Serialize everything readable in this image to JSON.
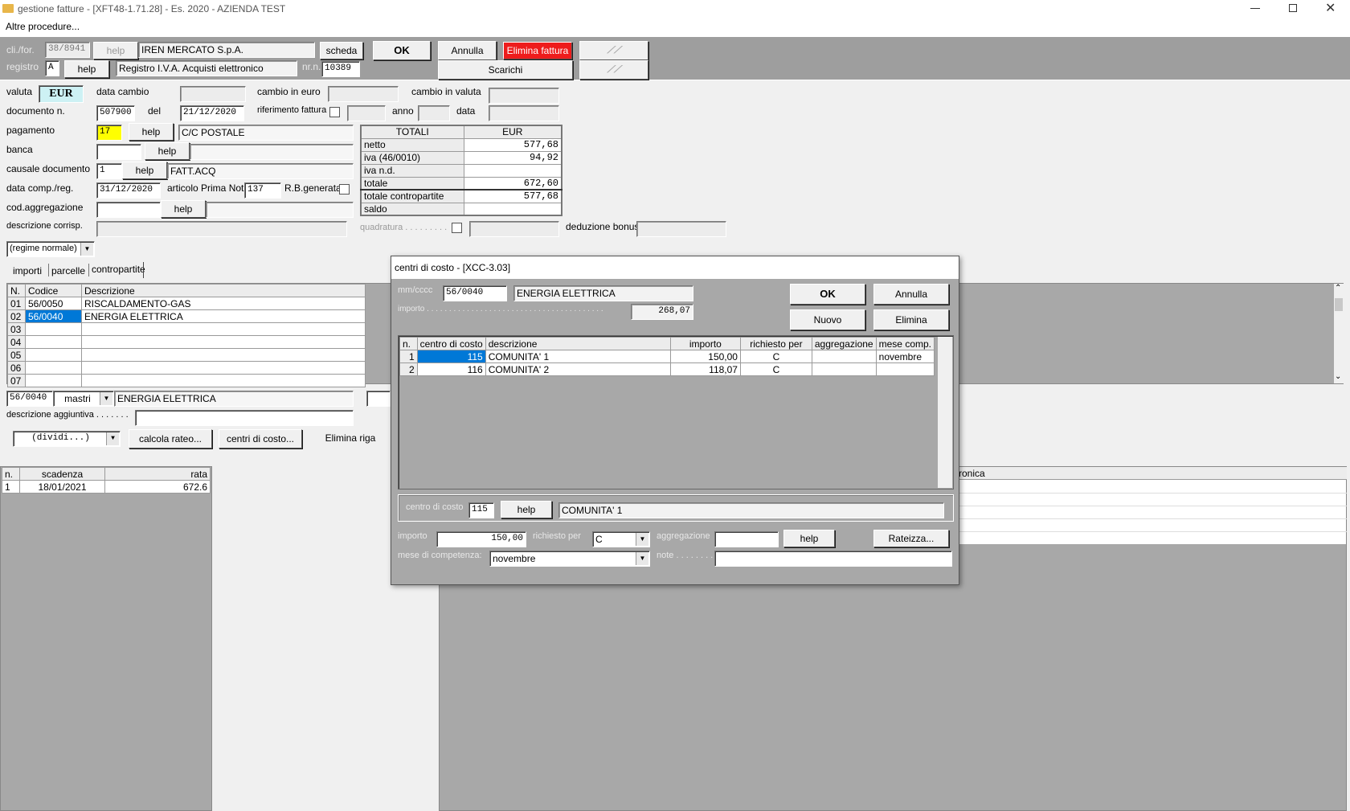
{
  "window": {
    "title": "gestione fatture - [XFT48-1.71.28] - Es. 2020 - AZIENDA TEST",
    "menu": "Altre procedure..."
  },
  "top": {
    "clifor_label": "cli./for.",
    "clifor_value": "38/8941",
    "help_label": "help",
    "clifor_name": "IREN MERCATO S.p.A.",
    "scheda_label": "scheda",
    "ok_label": "OK",
    "annulla_label": "Annulla",
    "elimina_fattura_label": "Elimina fattura",
    "scarichi_label": "Scarichi",
    "registro_label": "registro",
    "registro_value": "A",
    "registro_help": "help",
    "registro_name": "Registro I.V.A. Acquisti elettronico",
    "nr_label": "nr.n.",
    "nr_value": "10389"
  },
  "form": {
    "valuta_label": "valuta",
    "valuta_value": "EUR",
    "data_cambio_label": "data cambio",
    "cambio_euro_label": "cambio in euro",
    "cambio_valuta_label": "cambio in valuta",
    "documento_label": "documento n.",
    "documento_value": "507900",
    "del_label": "del",
    "del_value": "21/12/2020",
    "rif_fattura_label": "riferimento fattura",
    "anno_label": "anno",
    "data_label": "data",
    "pagamento_label": "pagamento",
    "pagamento_value": "17",
    "pagamento_help": "help",
    "pagamento_desc": "C/C POSTALE",
    "banca_label": "banca",
    "banca_help": "help",
    "causale_label": "causale documento",
    "causale_value": "1",
    "causale_help": "help",
    "causale_desc": "FATT.ACQ",
    "datacomp_label": "data comp./reg.",
    "datacomp_value": "31/12/2020",
    "articolo_label": "articolo Prima Nota",
    "articolo_value": "137",
    "rbgen_label": "R.B.generata",
    "codagg_label": "cod.aggregazione",
    "codagg_help": "help",
    "descorr_label": "descrizione corrisp.",
    "quadratura_label": "quadratura . . . . . . . . .",
    "deduzione_label": "deduzione bonus",
    "regime_value": "(regime normale)"
  },
  "totali": {
    "header": [
      "TOTALI",
      "EUR"
    ],
    "rows": [
      {
        "label": "netto",
        "value": "577,68"
      },
      {
        "label": "iva (46/0010)",
        "value": "94,92"
      },
      {
        "label": "iva n.d.",
        "value": ""
      },
      {
        "label": "totale",
        "value": "672,60"
      },
      {
        "label": "totale contropartite",
        "value": "577,68"
      },
      {
        "label": "saldo",
        "value": ""
      }
    ]
  },
  "tabs": [
    "importi",
    "parcelle",
    "contropartite"
  ],
  "contro": {
    "headers": [
      "N.",
      "Codice",
      "Descrizione"
    ],
    "rows": [
      {
        "n": "01",
        "code": "56/0050",
        "desc": "RISCALDAMENTO-GAS"
      },
      {
        "n": "02",
        "code": "56/0040",
        "desc": "ENERGIA ELETTRICA"
      },
      {
        "n": "03",
        "code": "",
        "desc": ""
      },
      {
        "n": "04",
        "code": "",
        "desc": ""
      },
      {
        "n": "05",
        "code": "",
        "desc": ""
      },
      {
        "n": "06",
        "code": "",
        "desc": ""
      },
      {
        "n": "07",
        "code": "",
        "desc": ""
      }
    ],
    "sel_code": "56/0040",
    "mastri": "mastri",
    "sel_desc": "ENERGIA ELETTRICA",
    "desc_agg_label": "descrizione aggiuntiva . . . . . . .",
    "dividi": "(dividi...)",
    "calcola_rateo": "calcola rateo...",
    "centri_costo": "centri di costo...",
    "elimina_riga": "Elimina riga"
  },
  "scadenze": {
    "headers": [
      "n.",
      "scadenza",
      "rata"
    ],
    "rows": [
      {
        "n": "1",
        "date": "18/01/2021",
        "rata": "672.6"
      }
    ]
  },
  "bg_right_header": "ronica",
  "dialog": {
    "title": "centri di costo - [XCC-3.03]",
    "mmcccc_label": "mm/cccc",
    "mmcccc_value": "56/0040",
    "mmcccc_desc": "ENERGIA ELETTRICA",
    "importo_label": "importo . . . . . . . . . . . . . . . . . . . . . . . . . . . . . . . . . . . . . . . .",
    "importo_value": "268,07",
    "ok": "OK",
    "annulla": "Annulla",
    "nuovo": "Nuovo",
    "elimina": "Elimina",
    "grid_headers": [
      "n.",
      "centro di costo",
      "descrizione",
      "importo",
      "richiesto per",
      "aggregazione",
      "mese comp."
    ],
    "grid_rows": [
      {
        "n": "1",
        "cc": "115",
        "desc": "COMUNITA' 1",
        "importo": "150,00",
        "rich": "C",
        "agg": "",
        "mese": "novembre"
      },
      {
        "n": "2",
        "cc": "116",
        "desc": "COMUNITA' 2",
        "importo": "118,07",
        "rich": "C",
        "agg": "",
        "mese": ""
      }
    ],
    "cc_label": "centro di costo",
    "cc_value": "115",
    "cc_help": "help",
    "cc_desc": "COMUNITA' 1",
    "imp_label": "importo",
    "imp_value": "150,00",
    "rich_label": "richiesto per",
    "rich_value": "C",
    "agg_label": "aggregazione",
    "agg_help": "help",
    "rateizza": "Rateizza...",
    "mese_label": "mese di competenza:",
    "mese_value": "novembre",
    "note_label": "note . . . . . . . ."
  }
}
